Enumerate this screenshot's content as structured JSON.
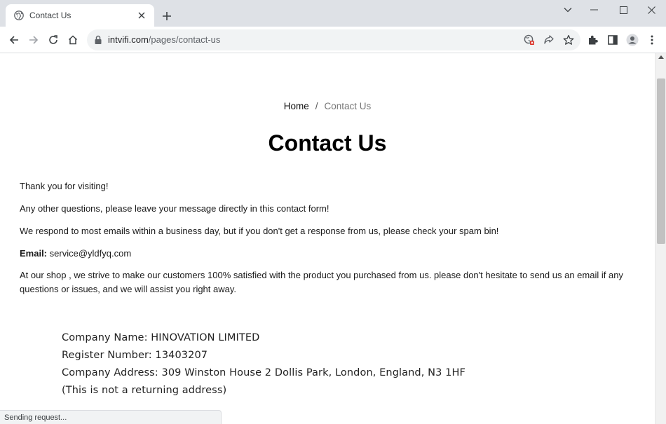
{
  "browser": {
    "tab": {
      "title": "Contact Us"
    },
    "address_bar": {
      "domain": "intvifi.com",
      "path": "/pages/contact-us"
    },
    "status_text": "Sending request..."
  },
  "page": {
    "breadcrumb": {
      "home": "Home",
      "separator": "/",
      "current": "Contact Us"
    },
    "title": "Contact Us",
    "paragraphs": {
      "thanks": "Thank you for visiting!",
      "questions": "Any other questions, please leave your message directly in this contact form!",
      "respond": "We respond to most emails within a business day, but if you don't get a response from us, please check your spam bin!",
      "satisfaction_line1": "At our shop , we strive to make our customers 100% satisfied with the product you purchased from us. please don't hesitate to send us an email if any",
      "satisfaction_line2": "questions or issues, and we will assist you right away."
    },
    "email": {
      "label": "Email:",
      "address": "service@yldfyq.com"
    },
    "company": {
      "name": "Company Name: HINOVATION LIMITED",
      "register": "Register Number:  13403207",
      "address": "Company Address: 309 Winston House 2 Dollis Park, London,  England, N3 1HF",
      "note": "(This is not a returning address)"
    }
  },
  "colors": {
    "tab_strip": "#dee1e6",
    "omnibox": "#f1f3f4",
    "text": "#1a1a1a",
    "muted": "#777777"
  },
  "icons": [
    "globe-icon",
    "close-icon",
    "plus-icon",
    "chevron-down-icon",
    "minimize-icon",
    "maximize-icon",
    "window-close-icon",
    "back-icon",
    "forward-icon",
    "reload-icon",
    "home-icon",
    "lock-icon",
    "blocked-site-icon",
    "share-icon",
    "star-icon",
    "extensions-icon",
    "side-panel-icon",
    "profile-icon",
    "menu-icon"
  ]
}
